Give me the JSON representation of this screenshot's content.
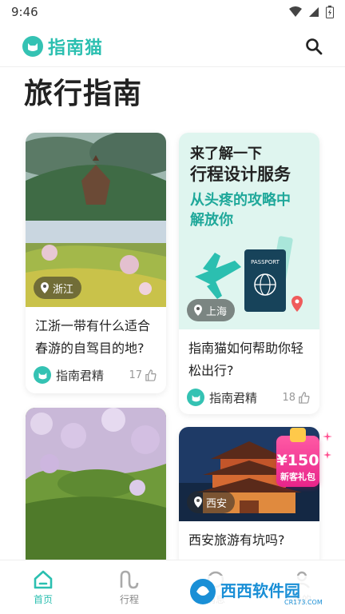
{
  "status_bar": {
    "time": "9:46"
  },
  "header": {
    "brand_name": "指南猫",
    "brand_icon": "cat-logo-icon",
    "search_icon": "search-icon"
  },
  "page_title": "旅行指南",
  "cards": [
    {
      "location": "浙江",
      "title": "江浙一带有什么适合春游的自驾目的地?",
      "author": "指南君精",
      "likes": "17"
    },
    {
      "promo_line1": "来了解一下",
      "promo_line2": "行程设计服务",
      "promo_line3": "从头疼的攻略中",
      "promo_line4": "解放你",
      "passport_label": "PASSPORT",
      "location": "上海",
      "title": "指南猫如何帮助你轻松出行?",
      "author": "指南君精",
      "likes": "18"
    },
    {
      "location": ""
    },
    {
      "location": "西安",
      "title": "西安旅游有坑吗?"
    }
  ],
  "gift_badge": {
    "amount": "¥150",
    "label": "新客礼包"
  },
  "bottom_nav": [
    {
      "label": "首页",
      "icon": "home-icon",
      "active": true
    },
    {
      "label": "行程",
      "icon": "route-icon",
      "active": false
    },
    {
      "label": "消息",
      "icon": "message-icon",
      "active": false
    },
    {
      "label": "我的",
      "icon": "profile-icon",
      "active": false
    }
  ],
  "watermark": {
    "text": "西西软件园",
    "subtext": "CR173.COM"
  },
  "colors": {
    "brand": "#2bbfb0",
    "promo_bg": "#dff5ef",
    "badge": "#e8248a"
  }
}
